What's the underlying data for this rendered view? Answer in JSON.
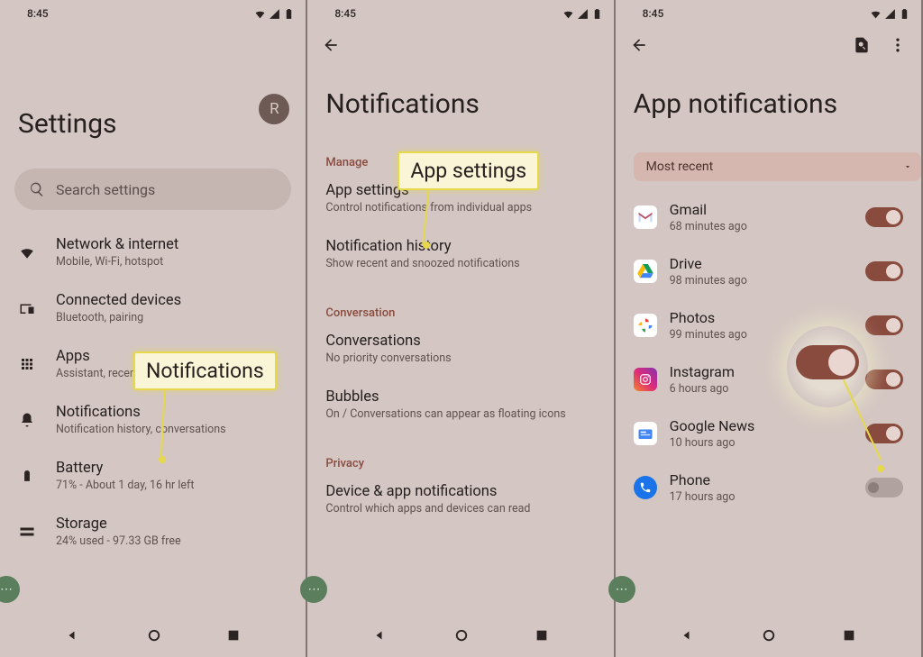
{
  "status_bar": {
    "time": "8:45"
  },
  "panel1": {
    "title": "Settings",
    "avatar_letter": "R",
    "search_placeholder": "Search settings",
    "items": [
      {
        "title": "Network & internet",
        "subtitle": "Mobile, Wi-Fi, hotspot"
      },
      {
        "title": "Connected devices",
        "subtitle": "Bluetooth, pairing"
      },
      {
        "title": "Apps",
        "subtitle": "Assistant, recent apps, default apps"
      },
      {
        "title": "Notifications",
        "subtitle": "Notification history, conversations"
      },
      {
        "title": "Battery",
        "subtitle": "71% - About 1 day, 16 hr left"
      },
      {
        "title": "Storage",
        "subtitle": "24% used - 97.33 GB free"
      }
    ],
    "callout_label": "Notifications"
  },
  "panel2": {
    "title": "Notifications",
    "sections": {
      "manage": {
        "header": "Manage",
        "items": [
          {
            "title": "App settings",
            "subtitle": "Control notifications from individual apps"
          },
          {
            "title": "Notification history",
            "subtitle": "Show recent and snoozed notifications"
          }
        ]
      },
      "conversation": {
        "header": "Conversation",
        "items": [
          {
            "title": "Conversations",
            "subtitle": "No priority conversations"
          },
          {
            "title": "Bubbles",
            "subtitle": "On / Conversations can appear as floating icons"
          }
        ]
      },
      "privacy": {
        "header": "Privacy",
        "items": [
          {
            "title": "Device & app notifications",
            "subtitle": "Control which apps and devices can read"
          }
        ]
      }
    },
    "callout_label": "App settings"
  },
  "panel3": {
    "title": "App notifications",
    "filter_label": "Most recent",
    "apps": [
      {
        "name": "Gmail",
        "time": "68 minutes ago",
        "on": true
      },
      {
        "name": "Drive",
        "time": "98 minutes ago",
        "on": true
      },
      {
        "name": "Photos",
        "time": "99 minutes ago",
        "on": true
      },
      {
        "name": "Instagram",
        "time": "6 hours ago",
        "on": true
      },
      {
        "name": "Google News",
        "time": "10 hours ago",
        "on": true
      },
      {
        "name": "Phone",
        "time": "17 hours ago",
        "on": false
      }
    ]
  }
}
